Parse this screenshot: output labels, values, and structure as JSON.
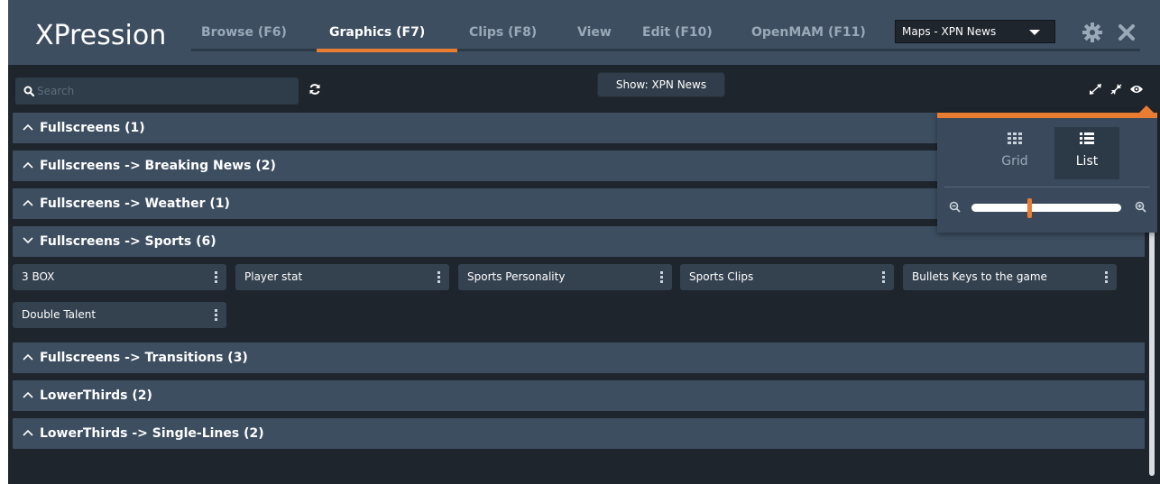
{
  "app": {
    "title": "XPression"
  },
  "tabs": [
    {
      "label": "Browse (F6)",
      "active": false
    },
    {
      "label": "Graphics (F7)",
      "active": true
    },
    {
      "label": "Clips (F8)",
      "active": false
    },
    {
      "label": "View",
      "active": false
    },
    {
      "label": "Edit (F10)",
      "active": false
    },
    {
      "label": "OpenMAM (F11)",
      "active": false
    }
  ],
  "maps_select": {
    "value": "Maps - XPN News"
  },
  "toolbar": {
    "search_placeholder": "Search",
    "show_label": "Show: XPN News",
    "icons": [
      "search-icon",
      "refresh-icon",
      "expand-icon",
      "collapse-icon",
      "eye-icon"
    ]
  },
  "groups": [
    {
      "label": "Fullscreens (1)",
      "expanded": false
    },
    {
      "label": "Fullscreens -> Breaking News (2)",
      "expanded": false
    },
    {
      "label": "Fullscreens -> Weather (1)",
      "expanded": false
    },
    {
      "label": "Fullscreens -> Sports (6)",
      "expanded": true
    },
    {
      "label": "Fullscreens -> Transitions (3)",
      "expanded": false
    },
    {
      "label": "LowerThirds (2)",
      "expanded": false
    },
    {
      "label": "LowerThirds -> Single-Lines (2)",
      "expanded": false
    }
  ],
  "sports_items": [
    "3 BOX",
    "Player stat",
    "Sports Personality",
    "Sports Clips",
    "Bullets Keys to the game",
    "Double Talent"
  ],
  "view_popup": {
    "options": [
      {
        "label": "Grid",
        "selected": false
      },
      {
        "label": "List",
        "selected": true
      }
    ],
    "zoom_level": 0.39
  },
  "colors": {
    "accent": "#e87d32",
    "header_bg": "#3d4e61",
    "panel_bg": "#1f252c",
    "item_bg": "#34414f"
  }
}
